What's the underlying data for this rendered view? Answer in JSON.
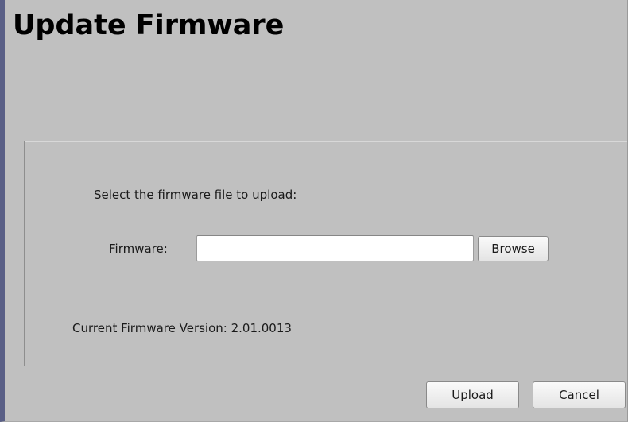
{
  "page": {
    "title": "Update Firmware"
  },
  "form": {
    "prompt": "Select the firmware file to upload:",
    "firmware_label": "Firmware:",
    "firmware_value": "",
    "browse_label": "Browse",
    "current_version_text": "Current Firmware Version: 2.01.0013"
  },
  "actions": {
    "upload_label": "Upload",
    "cancel_label": "Cancel"
  },
  "colors": {
    "background": "#c0c0c0",
    "left_edge": "#5a5f86",
    "panel_border": "#8e8e8e",
    "input_background": "#ffffff"
  }
}
